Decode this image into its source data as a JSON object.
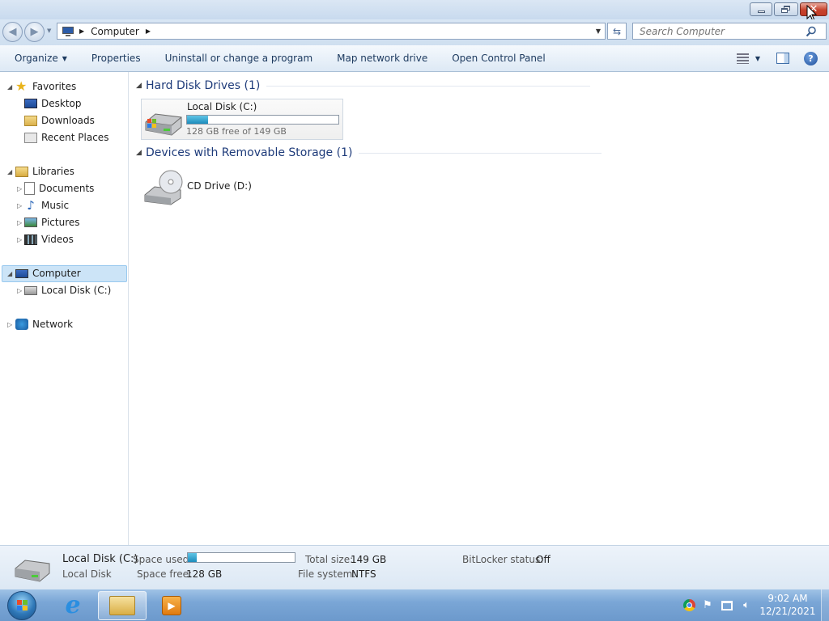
{
  "window": {
    "title": "",
    "controls": {
      "minimize": "minimize",
      "maximize": "restore",
      "close": "close"
    }
  },
  "address_bar": {
    "path": [
      "Computer"
    ],
    "search_placeholder": "Search Computer"
  },
  "toolbar": {
    "organize": "Organize",
    "properties": "Properties",
    "uninstall": "Uninstall or change a program",
    "map_drive": "Map network drive",
    "control_panel": "Open Control Panel"
  },
  "nav": {
    "favorites": "Favorites",
    "desktop": "Desktop",
    "downloads": "Downloads",
    "recent": "Recent Places",
    "libraries": "Libraries",
    "documents": "Documents",
    "music": "Music",
    "pictures": "Pictures",
    "videos": "Videos",
    "computer": "Computer",
    "local_disk": "Local Disk (C:)",
    "network": "Network"
  },
  "content": {
    "hdd_group": "Hard Disk Drives (1)",
    "removable_group": "Devices with Removable Storage (1)",
    "local_disk": {
      "name": "Local Disk (C:)",
      "free_text": "128 GB free of 149 GB",
      "used_fraction": 0.14
    },
    "cd_drive": {
      "name": "CD Drive (D:)"
    }
  },
  "status": {
    "name": "Local Disk (C:)",
    "type": "Local Disk",
    "space_used_label": "Space used:",
    "space_free_label": "Space free:",
    "space_free": "128 GB",
    "total_size_label": "Total size:",
    "total_size": "149 GB",
    "file_system_label": "File system:",
    "file_system": "NTFS",
    "bitlocker_label": "BitLocker status:",
    "bitlocker": "Off",
    "used_fraction": 0.08
  },
  "taskbar": {
    "time": "9:02 AM",
    "date": "12/21/2021",
    "icons": [
      "start-orb",
      "internet-explorer",
      "windows-explorer",
      "media-player"
    ],
    "tray": [
      "chrome",
      "flag",
      "network",
      "volume"
    ]
  },
  "colors": {
    "selection": "#cce4f7",
    "link_blue": "#1e3b7a",
    "close_red": "#c7432e"
  }
}
